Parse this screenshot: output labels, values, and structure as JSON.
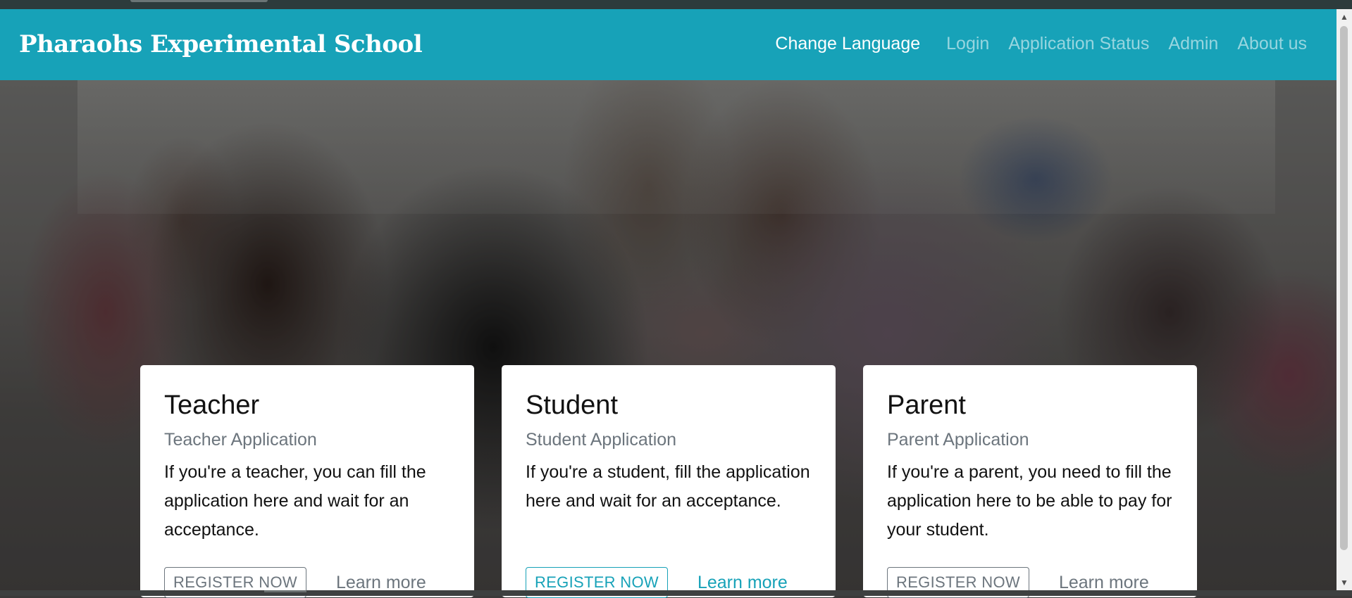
{
  "navbar": {
    "brand": "Pharaohs Experimental School",
    "items": [
      {
        "label": "Change Language",
        "active": true
      },
      {
        "label": "Login",
        "active": false
      },
      {
        "label": "Application Status",
        "active": false
      },
      {
        "label": "Admin",
        "active": false
      },
      {
        "label": "About us",
        "active": false
      }
    ]
  },
  "cards": [
    {
      "title": "Teacher",
      "subtitle": "Teacher Application",
      "text": "If you're a teacher, you can fill the application here and wait for an acceptance.",
      "button": "REGISTER NOW",
      "link": "Learn more"
    },
    {
      "title": "Student",
      "subtitle": "Student Application",
      "text": "If you're a student, fill the application here and wait for an acceptance.",
      "button": "REGISTER NOW",
      "link": "Learn more"
    },
    {
      "title": "Parent",
      "subtitle": "Parent Application",
      "text": "If you're a parent, you need to fill the application here to be able to pay for your student.",
      "button": "REGISTER NOW",
      "link": "Learn more"
    }
  ],
  "colors": {
    "primary": "#17a2b8",
    "muted": "#6c757d",
    "card_bg": "#ffffff"
  }
}
